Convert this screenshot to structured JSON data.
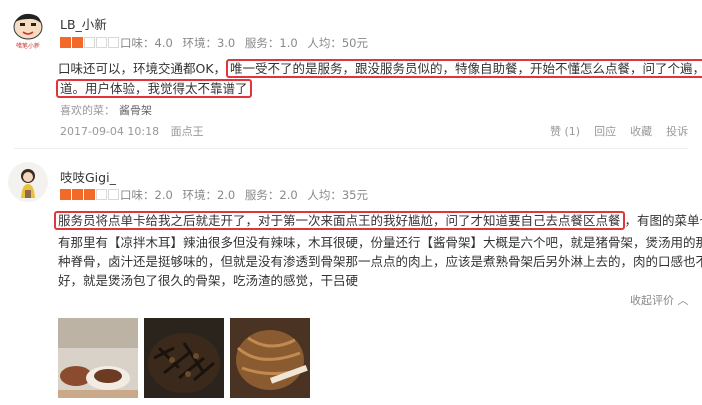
{
  "reviews": [
    {
      "username": "LB_小新",
      "avatar_caption": "蜡笔小新",
      "rating_stars": 2,
      "scores": {
        "taste": "口味：4.0",
        "environment": "环境：3.0",
        "service": "服务：1.0",
        "per_capita": "人均：50元"
      },
      "text_line1_plain": "口味还可以，环境交通都OK，",
      "text_line1_marked": "唯一受不了的是服务，跟没服务员似的，特像自助餐，开始不懂怎么点餐，问了个遍，才知",
      "text_line2_marked": "道。用户体验，我觉得太不靠谱了",
      "dish_label": "喜欢的菜：",
      "dish_name": "酱骨架",
      "timestamp": "2017-09-04 10:18",
      "shop": "面点王",
      "actions": {
        "like": "赞 (1)",
        "reply": "回应",
        "favorite": "收藏",
        "report": "投诉"
      }
    },
    {
      "username": "吱吱Gigi_",
      "rating_stars": 3,
      "scores": {
        "taste": "口味：2.0",
        "environment": "环境：2.0",
        "service": "服务：2.0",
        "per_capita": "人均：35元"
      },
      "text_line1_marked": "服务员将点单卡给我之后就走开了，对于第一次来面点王的我好尴尬，问了才知道要自己去点餐区点餐",
      "text_line1_plain": "，有图的菜单也只",
      "text_line2": "有那里有【凉拌木耳】辣油很多但没有辣味，木耳很硬，份量还行【酱骨架】大概是六个吧，就是猪骨架，煲汤用的那",
      "text_line3": "种脊骨，卤汁还是挺够味的，但就是没有渗透到骨架那一点点的肉上，应该是煮熟骨架后另外淋上去的，肉的口感也不太",
      "text_line4": "好，就是煲汤包了很久的骨架，吃汤渣的感觉，干吕硬",
      "collapse_label": "收起评价 ︿"
    }
  ],
  "colors": {
    "star": "#f26a2a",
    "highlight_border": "#e0353a"
  }
}
